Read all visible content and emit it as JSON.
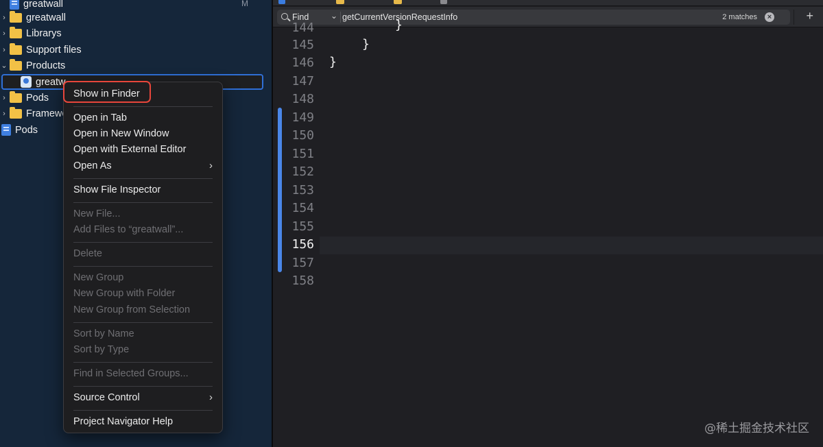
{
  "navigator": {
    "items": [
      {
        "label": "greatwall",
        "badge": "M"
      },
      {
        "label": "greatwall"
      },
      {
        "label": "Librarys"
      },
      {
        "label": "Support files"
      },
      {
        "label": "Products"
      },
      {
        "label": "greatw"
      },
      {
        "label": "Pods"
      },
      {
        "label": "Framewo"
      },
      {
        "label": "Pods"
      }
    ]
  },
  "context_menu": {
    "items": [
      {
        "label": "Show in Finder"
      },
      {
        "label": "Open in Tab"
      },
      {
        "label": "Open in New Window"
      },
      {
        "label": "Open with External Editor"
      },
      {
        "label": "Open As"
      },
      {
        "label": "Show File Inspector"
      },
      {
        "label": "New File..."
      },
      {
        "label": "Add Files to “greatwall”..."
      },
      {
        "label": "Delete"
      },
      {
        "label": "New Group"
      },
      {
        "label": "New Group with Folder"
      },
      {
        "label": "New Group from Selection"
      },
      {
        "label": "Sort by Name"
      },
      {
        "label": "Sort by Type"
      },
      {
        "label": "Find in Selected Groups..."
      },
      {
        "label": "Source Control"
      },
      {
        "label": "Project Navigator Help"
      }
    ]
  },
  "find_bar": {
    "mode": "Find",
    "query": "getCurrentVersionRequestInfo",
    "matches": "2 matches",
    "plus": "+"
  },
  "editor": {
    "line_numbers": [
      "144",
      "145",
      "146",
      "147",
      "148",
      "149",
      "150",
      "151",
      "152",
      "153",
      "154",
      "155",
      "156",
      "157",
      "158"
    ],
    "active_line": "156",
    "code": {
      "line144": "}",
      "line145": "}",
      "line146": "}"
    }
  },
  "watermark": "@稀土掘金技术社区"
}
